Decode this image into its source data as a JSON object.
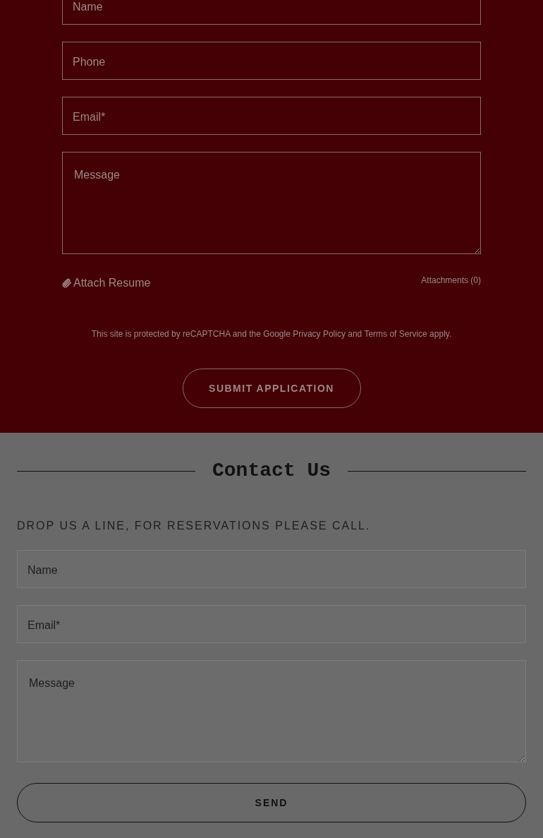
{
  "application_form": {
    "fields": [
      {
        "placeholder": "Name",
        "kind": "input"
      },
      {
        "placeholder": "Phone",
        "kind": "input"
      },
      {
        "placeholder": "Email*",
        "kind": "input"
      },
      {
        "placeholder": "Message",
        "kind": "textarea"
      }
    ],
    "attach_label": "Attach Resume",
    "attachments": "Attachments (0)",
    "recaptcha": {
      "before": "This site is protected by reCAPTCHA and the Google",
      "privacy": "Privacy Policy",
      "middle": "and",
      "terms": "Terms of Service",
      "after": "apply."
    },
    "submit": "SUBMIT APPLICATION"
  },
  "contact": {
    "title": "Contact Us",
    "subtitle": "DROP US A LINE, FOR RESERVATIONS PLEASE CALL.",
    "fields": [
      {
        "placeholder": "Name",
        "kind": "input"
      },
      {
        "placeholder": "Email*",
        "kind": "input"
      },
      {
        "placeholder": "Message",
        "kind": "textarea"
      }
    ],
    "send": "SEND"
  }
}
